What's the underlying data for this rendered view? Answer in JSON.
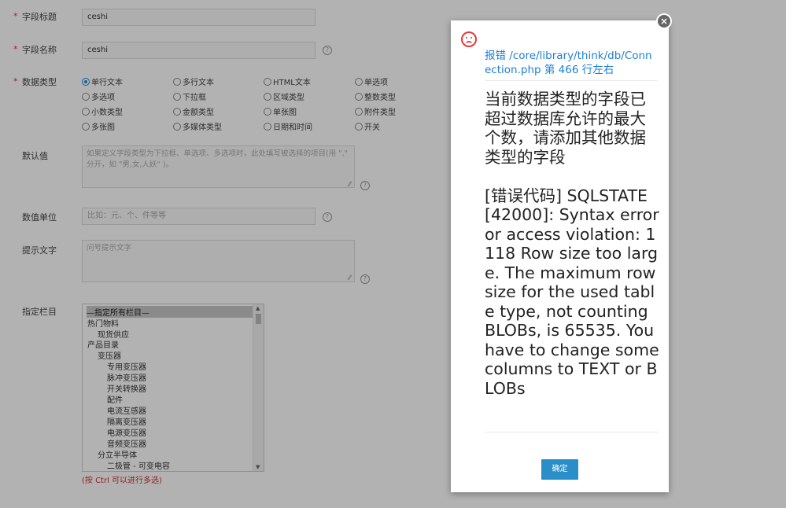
{
  "form": {
    "field_title": {
      "label": "字段标题",
      "value": "ceshi"
    },
    "field_name": {
      "label": "字段名称",
      "value": "ceshi"
    },
    "data_type": {
      "label": "数据类型",
      "options": [
        "单行文本",
        "多行文本",
        "HTML文本",
        "单选项",
        "多选项",
        "下拉框",
        "区域类型",
        "整数类型",
        "小数类型",
        "金额类型",
        "单张图",
        "附件类型",
        "多张图",
        "多媒体类型",
        "日期和时间",
        "开关"
      ],
      "selected": "单行文本"
    },
    "default_value": {
      "label": "默认值",
      "placeholder": "如果定义字段类型为下拉框、单选项、多选项时，此处填写被选择的项目(用 \",\" 分开，如 \"男,女,人妖\" )。"
    },
    "unit": {
      "label": "数值单位",
      "placeholder": "比如：元、个、件等等"
    },
    "tip": {
      "label": "提示文字",
      "placeholder": "问号提示文字"
    },
    "column": {
      "label": "指定栏目",
      "items": [
        "—指定所有栏目—",
        "热门物料",
        "现货供应",
        "产品目录",
        "变压器",
        "专用变压器",
        "脉冲变压器",
        "开关转换器",
        "配件",
        "电流互感器",
        "隔离变压器",
        "电源变压器",
        "音频变压器",
        "分立半导体",
        "二极管 - 可变电容"
      ],
      "hint": "(按 Ctrl 可以进行多选)"
    }
  },
  "dialog": {
    "icon": "sad-face-icon",
    "location": "报错 /core/library/think/db/Connection.php 第 466 行左右",
    "message": "当前数据类型的字段已超过数据库允许的最大个数，请添加其他数据类型的字段\n\n[错误代码] SQLSTATE[42000]: Syntax error or access violation: 1118 Row size too large. The maximum row size for the used table type, not counting BLOBs, is 65535. You have to change some columns to TEXT or BLOBs",
    "ok_label": "确定",
    "close_icon": "close-icon"
  },
  "colors": {
    "accent": "#2a8ec9",
    "link": "#1e7fd6",
    "error": "#e53935",
    "required": "#e03030"
  }
}
